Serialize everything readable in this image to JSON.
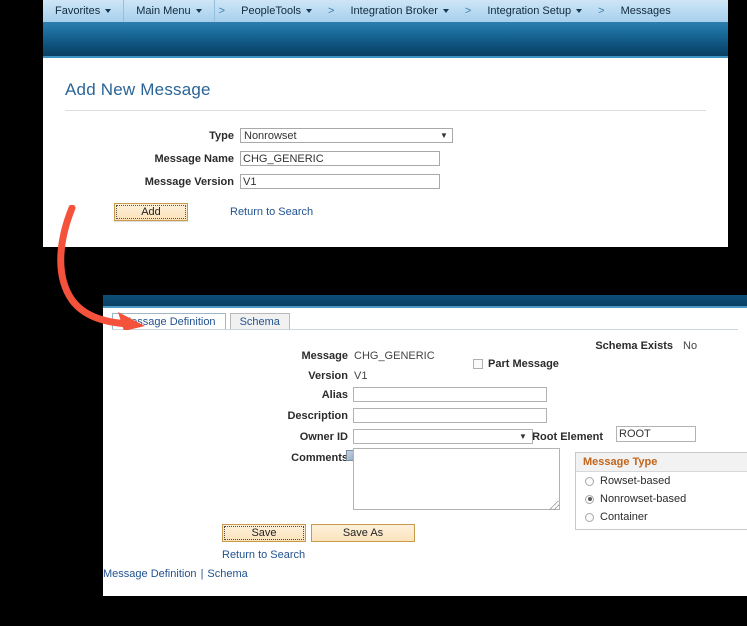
{
  "breadcrumb": {
    "items": [
      {
        "label": "Favorites",
        "has_caret": true
      },
      {
        "label": "Main Menu",
        "has_caret": true
      },
      {
        "label": "PeopleTools",
        "has_caret": true
      },
      {
        "label": "Integration Broker",
        "has_caret": true
      },
      {
        "label": "Integration Setup",
        "has_caret": true
      },
      {
        "label": "Messages",
        "has_caret": false
      }
    ],
    "separator": ">"
  },
  "add_panel": {
    "title": "Add New Message",
    "fields": {
      "type_label": "Type",
      "type_value": "Nonrowset",
      "name_label": "Message Name",
      "name_value": "CHG_GENERIC",
      "version_label": "Message Version",
      "version_value": "V1"
    },
    "add_button": "Add",
    "return_link": "Return to Search"
  },
  "def_panel": {
    "tabs": [
      {
        "label": "Message Definition",
        "active": true
      },
      {
        "label": "Schema",
        "active": false
      }
    ],
    "left": {
      "message_label": "Message",
      "message_value": "CHG_GENERIC",
      "version_label": "Version",
      "version_value": "V1",
      "alias_label": "Alias",
      "alias_value": "",
      "description_label": "Description",
      "description_value": "",
      "owner_label": "Owner ID",
      "owner_value": "",
      "comments_label": "Comments",
      "comments_value": ""
    },
    "right": {
      "schema_exists_label": "Schema Exists",
      "schema_exists_value": "No",
      "part_message_label": "Part Message",
      "part_message_checked": false,
      "root_element_label": "Root Element",
      "root_element_value": "ROOT"
    },
    "message_type": {
      "title": "Message Type",
      "options": [
        {
          "label": "Rowset-based",
          "selected": false
        },
        {
          "label": "Nonrowset-based",
          "selected": true
        },
        {
          "label": "Container",
          "selected": false
        }
      ]
    },
    "actions": {
      "save": "Save",
      "save_as": "Save As",
      "return_link": "Return to Search",
      "footer_left": "Message Definition",
      "footer_sep": "|",
      "footer_right": "Schema"
    }
  },
  "annotation": {
    "arrow_color": "#f4523b",
    "arrow_name": "callout-arrow"
  },
  "colors": {
    "accent_blue": "#23538f",
    "header_blue": "#0a3f63",
    "button_orange_border": "#c79a4e",
    "message_type_heading": "#c2651c"
  }
}
